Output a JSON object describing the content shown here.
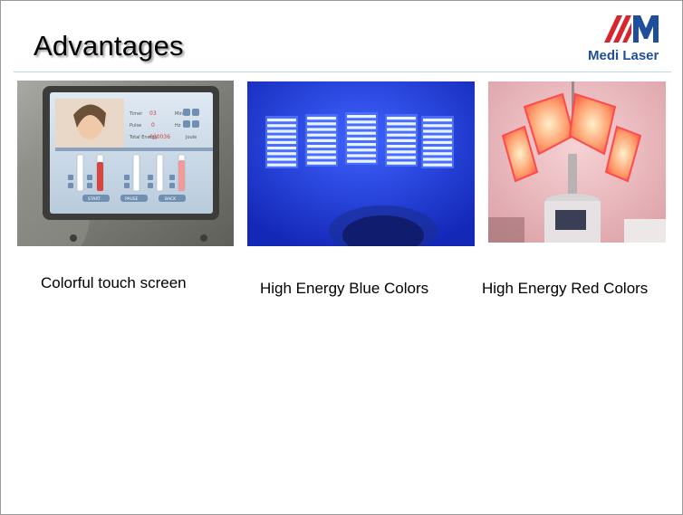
{
  "slide": {
    "title": "Advantages",
    "logo_text": "Medi Laser",
    "captions": [
      "Colorful touch screen",
      "High Energy Blue Colors",
      "High Energy Red Colors"
    ]
  },
  "screen": {
    "labels": [
      "Timer",
      "Pulse",
      "Total Energy"
    ],
    "values": [
      "03",
      "0",
      "000036"
    ],
    "units": [
      "Min",
      "Hz",
      "Joule"
    ],
    "buttons": [
      "START",
      "PAUSE",
      "BACK"
    ]
  },
  "colors": {
    "title_text": "#000000",
    "logo_red": "#d8262e",
    "logo_blue": "#1f4f9b",
    "divider": "#b9d9df",
    "blue_light": "#1d3de0",
    "red_light": "#ff3a3a"
  }
}
